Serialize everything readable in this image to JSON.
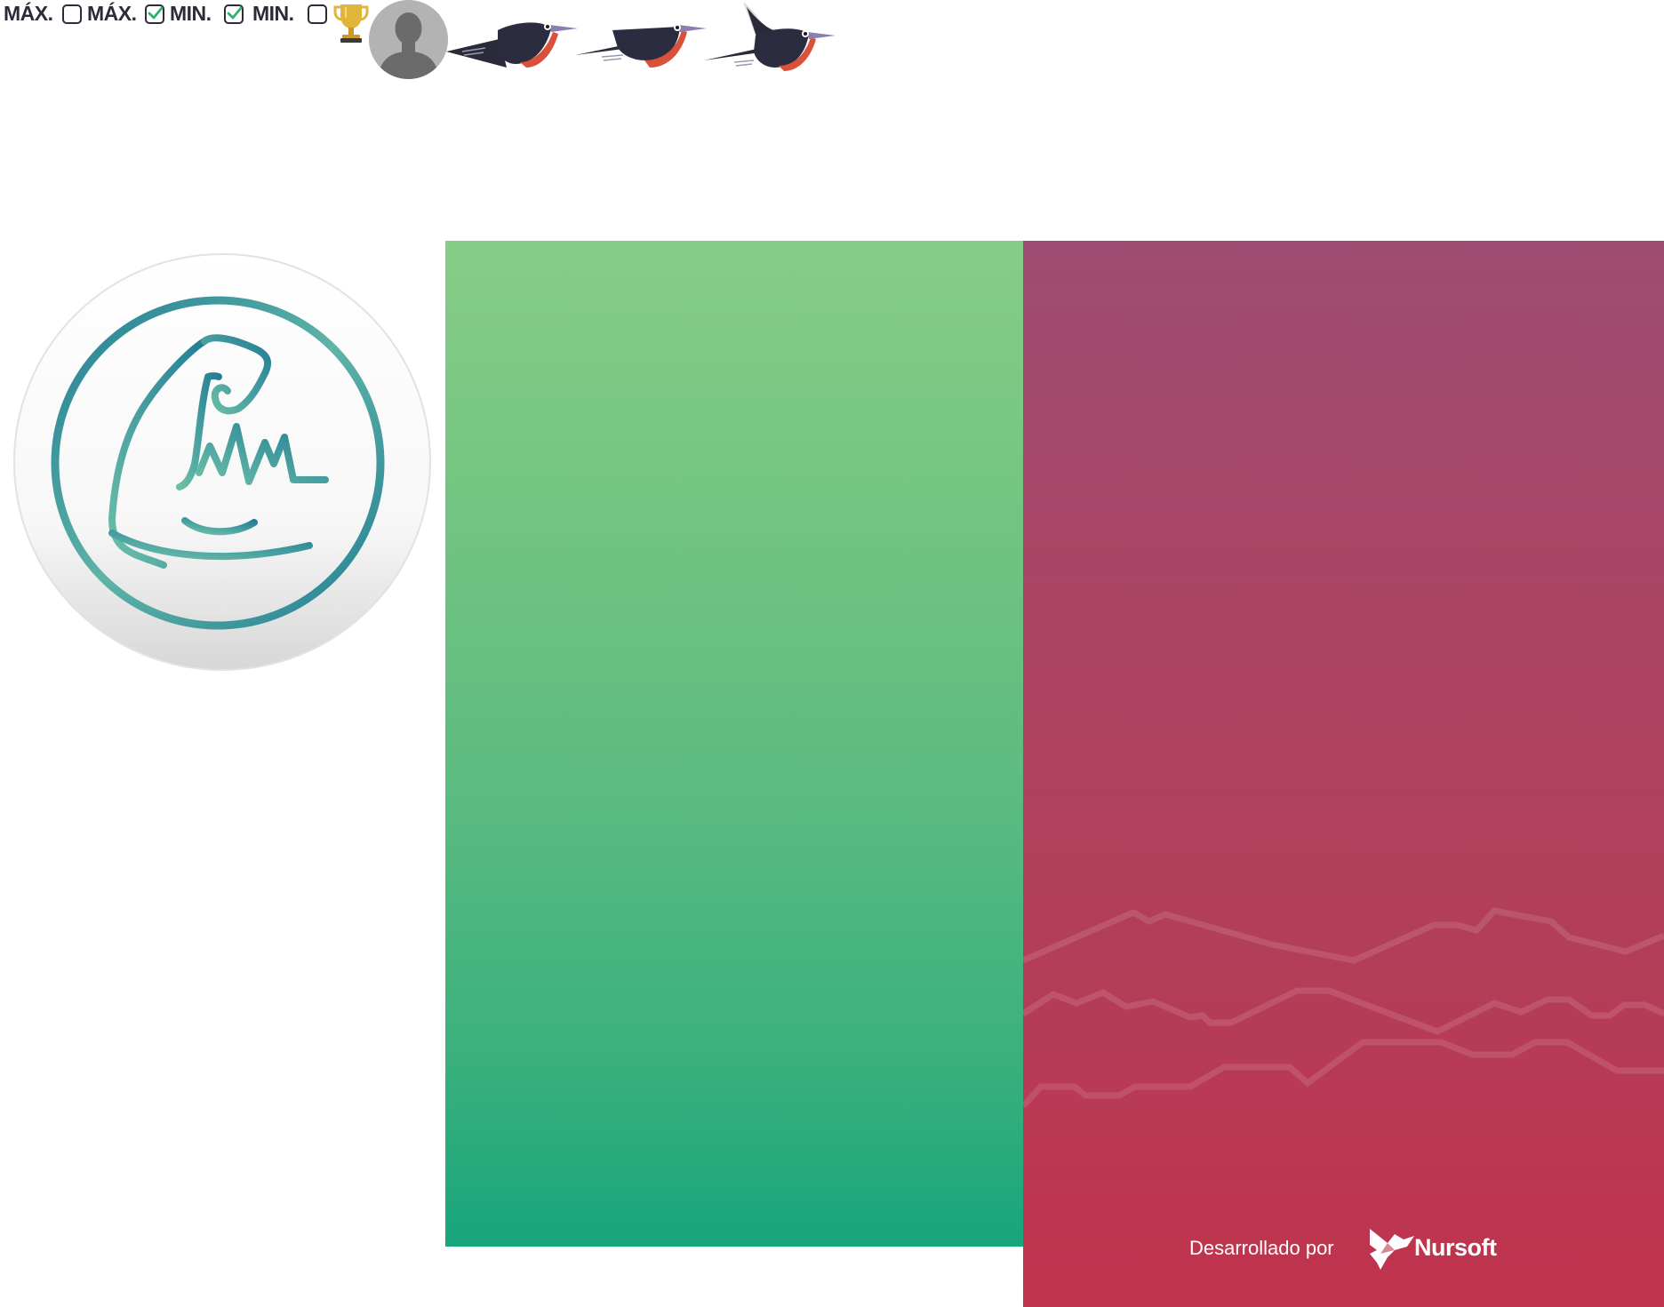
{
  "toolbar": {
    "labels": [
      "MÁX.",
      "MÁX.",
      "MIN.",
      "MIN."
    ],
    "checkboxes": [
      {
        "checked": false
      },
      {
        "checked": true
      },
      {
        "checked": true
      },
      {
        "checked": false
      }
    ],
    "icons": [
      "trophy-icon",
      "user-avatar-icon",
      "bird-icon",
      "bird-icon",
      "bird-icon"
    ]
  },
  "logo": {
    "icon": "wizard-hat-pulse-logo"
  },
  "panels": {
    "left": {
      "colors": [
        "#87cd87",
        "#18a57c"
      ]
    },
    "right": {
      "colors": [
        "#9e4c71",
        "#c0334c"
      ]
    }
  },
  "footer": {
    "developed_by": "Desarrollado por",
    "brand": "Nursoft"
  },
  "colors": {
    "label": "#2b2b3a",
    "check_green": "#2db36e",
    "logo_teal": "#237d96",
    "logo_mint": "#6bbfa8"
  }
}
